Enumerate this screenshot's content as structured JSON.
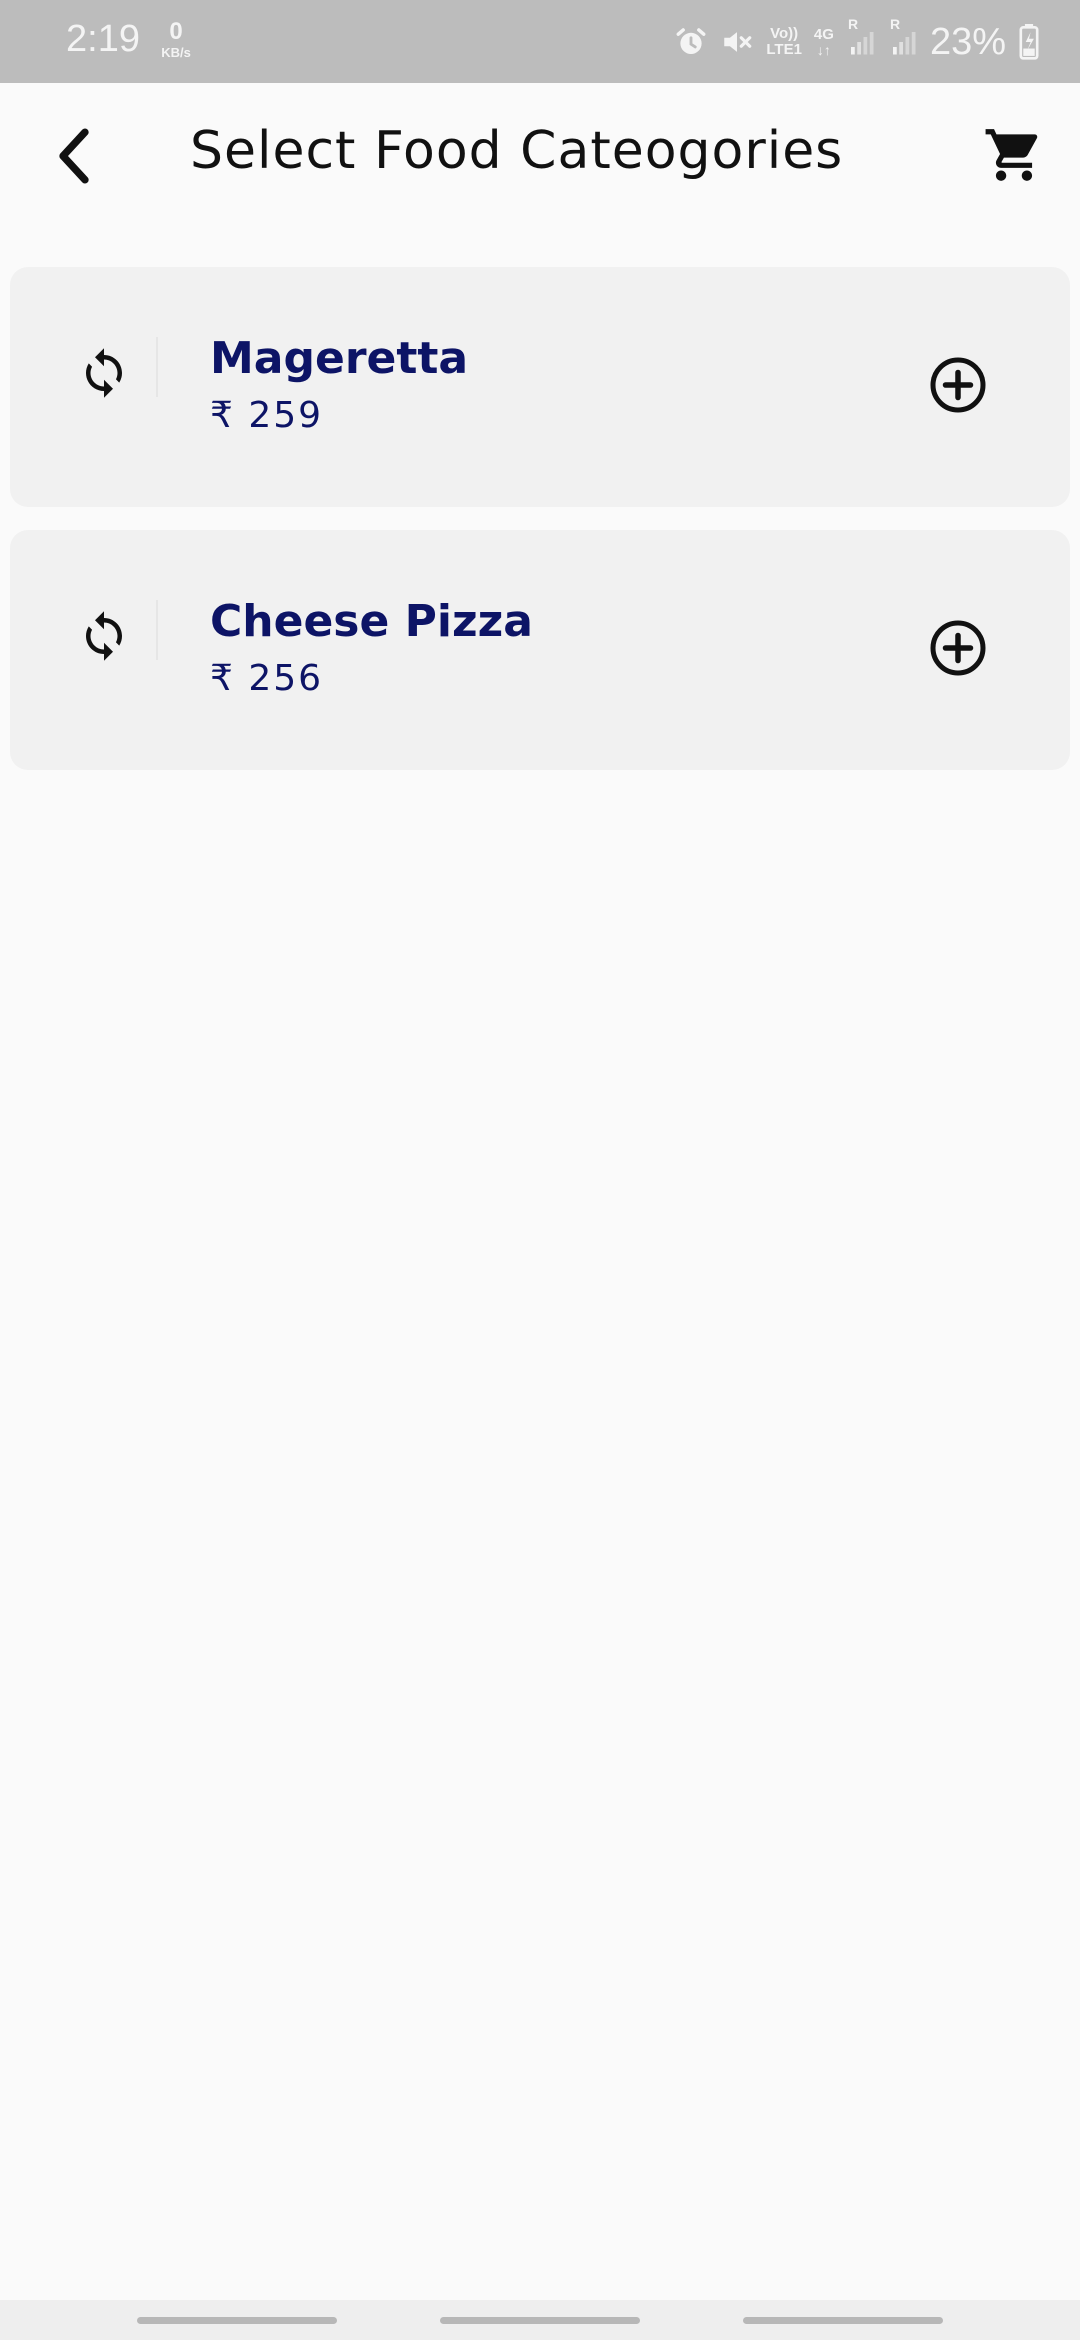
{
  "status_bar": {
    "time": "2:19",
    "net_speed_value": "0",
    "net_speed_unit": "KB/s",
    "volte_line1": "Vo))",
    "volte_line2": "LTE1",
    "network_type": "4G",
    "roaming_1": "R",
    "roaming_2": "R",
    "battery_percent": "23%",
    "icons": [
      "alarm-icon",
      "mute-icon",
      "volte-icon",
      "data-arrows-icon",
      "signal-icon",
      "signal-icon",
      "battery-charging-icon"
    ]
  },
  "header": {
    "title": "Select Food Cateogories",
    "back_icon": "chevron-left-icon",
    "cart_icon": "shopping-cart-icon"
  },
  "items": [
    {
      "name": "Mageretta",
      "currency": "₹",
      "price": "259",
      "price_text": "₹ 259",
      "left_icon": "refresh-icon",
      "action_icon": "add-circle-icon"
    },
    {
      "name": "Cheese Pizza",
      "currency": "₹",
      "price": "256",
      "price_text": "₹ 256",
      "left_icon": "refresh-icon",
      "action_icon": "add-circle-icon"
    }
  ],
  "colors": {
    "status_bar_bg": "#bcbcbc",
    "page_bg": "#fafafa",
    "card_bg": "#f1f1f1",
    "item_text": "#0d1466",
    "title_text": "#111111"
  }
}
